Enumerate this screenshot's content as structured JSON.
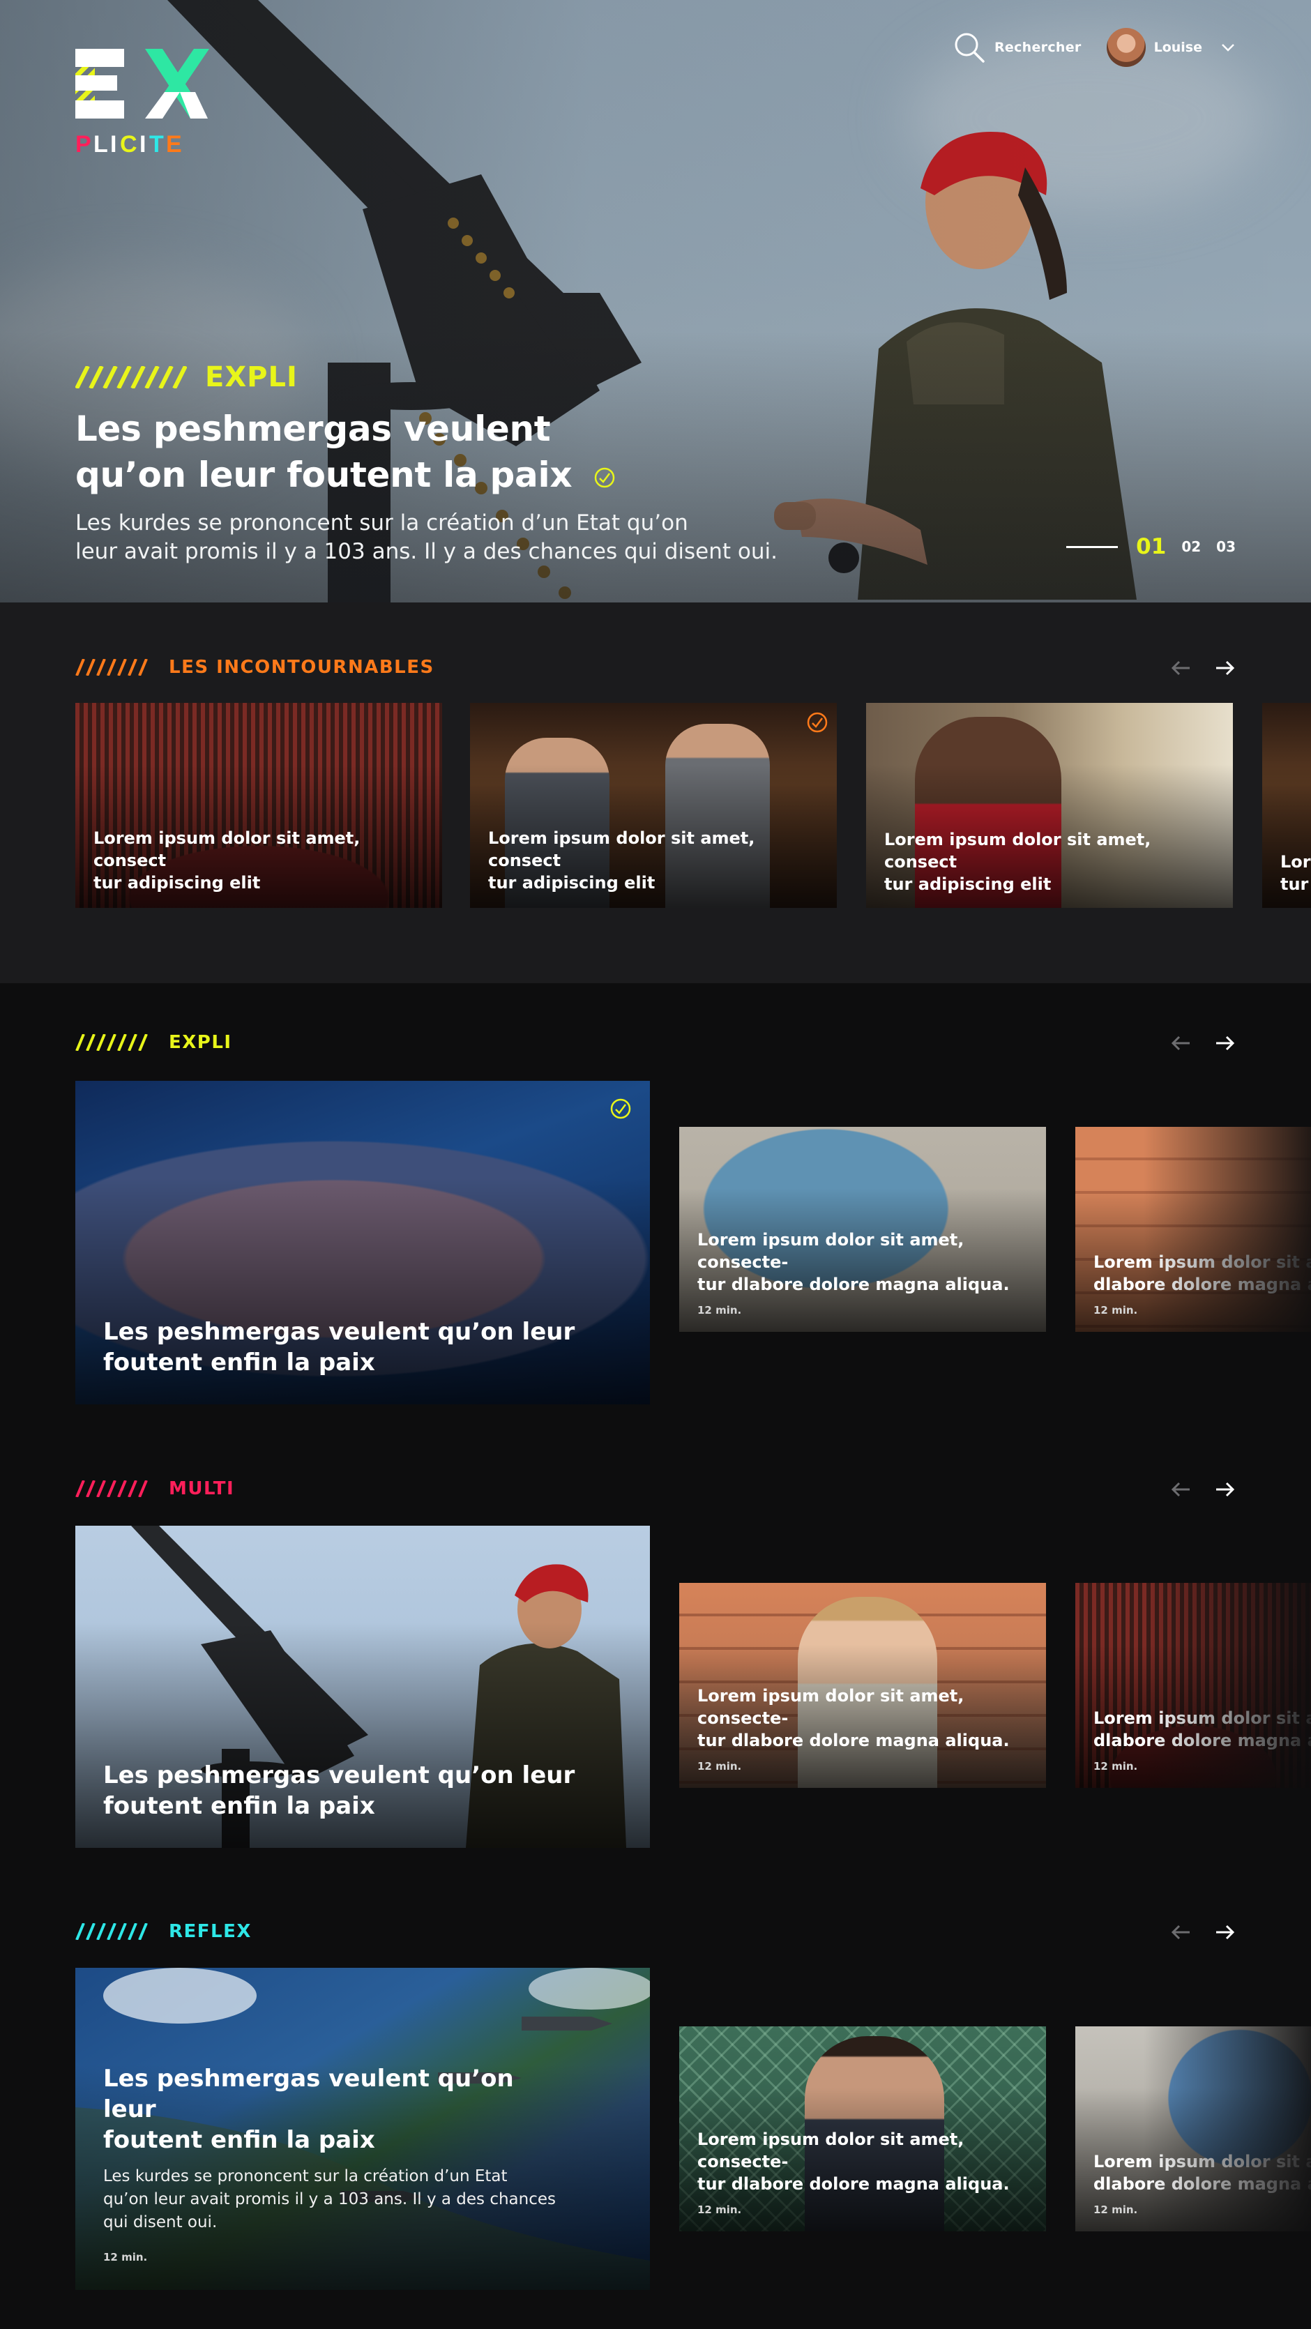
{
  "brand": {
    "logo_top": "EX",
    "logo_bottom": "PLICITE"
  },
  "header": {
    "search_label": "Rechercher",
    "user_name": "Louise"
  },
  "hero": {
    "category": "EXPLI",
    "title_line1": "Les peshmergas veulent",
    "title_line2": "qu’on leur foutent la paix",
    "description_line1": "Les kurdes se prononcent sur la création d’un Etat qu’on",
    "description_line2": "leur avait promis il y a 103 ans. Il y a des chances qui disent oui.",
    "pager": {
      "current": "01",
      "pages": [
        "02",
        "03"
      ]
    }
  },
  "colors": {
    "yellow": "#e8f51a",
    "orange": "#ff7a1a",
    "red": "#ff1f5a",
    "cyan": "#2ee7e7",
    "dark": "#0d0d0e",
    "band": "#1b1b1d"
  },
  "sections": {
    "incontournables": {
      "title": "LES INCONTOURNABLES",
      "cards": [
        {
          "line1": "Lorem ipsum dolor sit amet, consect",
          "line2": "tur adipiscing elit"
        },
        {
          "line1": "Lorem ipsum dolor sit amet, consect",
          "line2": "tur adipiscing elit"
        },
        {
          "line1": "Lorem ipsum dolor sit amet, consect",
          "line2": "tur adipiscing elit"
        },
        {
          "line1": "Lore",
          "line2": "tur"
        }
      ]
    },
    "expli": {
      "title": "EXPLI",
      "featured": {
        "line1": "Les peshmergas veulent qu’on leur",
        "line2": "foutent enfin la paix"
      },
      "cards": [
        {
          "line1": "Lorem ipsum dolor sit amet, consecte-",
          "line2": "tur dlabore dolore magna aliqua.",
          "duration": "12 min."
        },
        {
          "line1": "Lorem ipsum dolor sit ame",
          "line2": "dlabore dolore magna aliqu",
          "duration": "12 min."
        }
      ]
    },
    "multi": {
      "title": "MULTI",
      "featured": {
        "line1": "Les peshmergas veulent qu’on leur",
        "line2": "foutent enfin la paix"
      },
      "cards": [
        {
          "line1": "Lorem ipsum dolor sit amet, consecte-",
          "line2": "tur dlabore dolore magna aliqua.",
          "duration": "12 min."
        },
        {
          "line1": "Lorem ipsum dolor sit amet, c",
          "line2": "dlabore dolore magna aliqua.",
          "duration": "12 min."
        }
      ]
    },
    "reflex": {
      "title": "REFLEX",
      "featured": {
        "line1": "Les peshmergas veulent qu’on leur",
        "line2": "foutent enfin la paix",
        "desc_line1": "Les kurdes se prononcent sur la création d’un Etat",
        "desc_line2": "qu’on leur avait promis il y a 103 ans. Il y a des chances",
        "desc_line3": "qui disent oui.",
        "duration": "12 min."
      },
      "cards": [
        {
          "line1": "Lorem ipsum dolor sit amet, consecte-",
          "line2": "tur dlabore dolore magna aliqua.",
          "duration": "12 min."
        },
        {
          "line1": "Lorem ipsum dolor sit ame",
          "line2": "dlabore dolore magna aliqu",
          "duration": "12 min."
        }
      ]
    }
  }
}
